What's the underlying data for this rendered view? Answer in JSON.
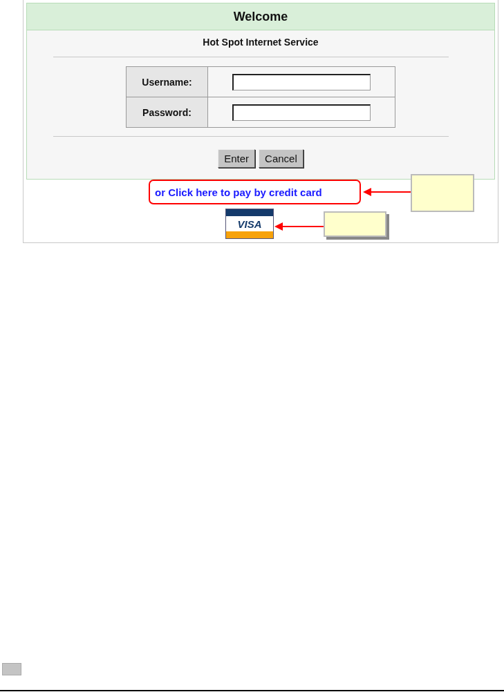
{
  "header": {
    "title": "Welcome"
  },
  "subtitle": "Hot Spot Internet Service",
  "fields": [
    {
      "label": "Username:"
    },
    {
      "label": "Password:"
    }
  ],
  "buttons": [
    "Enter",
    "Cancel"
  ],
  "pay_link": "or Click here to pay by credit card",
  "card_logo": {
    "text": "VISA"
  }
}
